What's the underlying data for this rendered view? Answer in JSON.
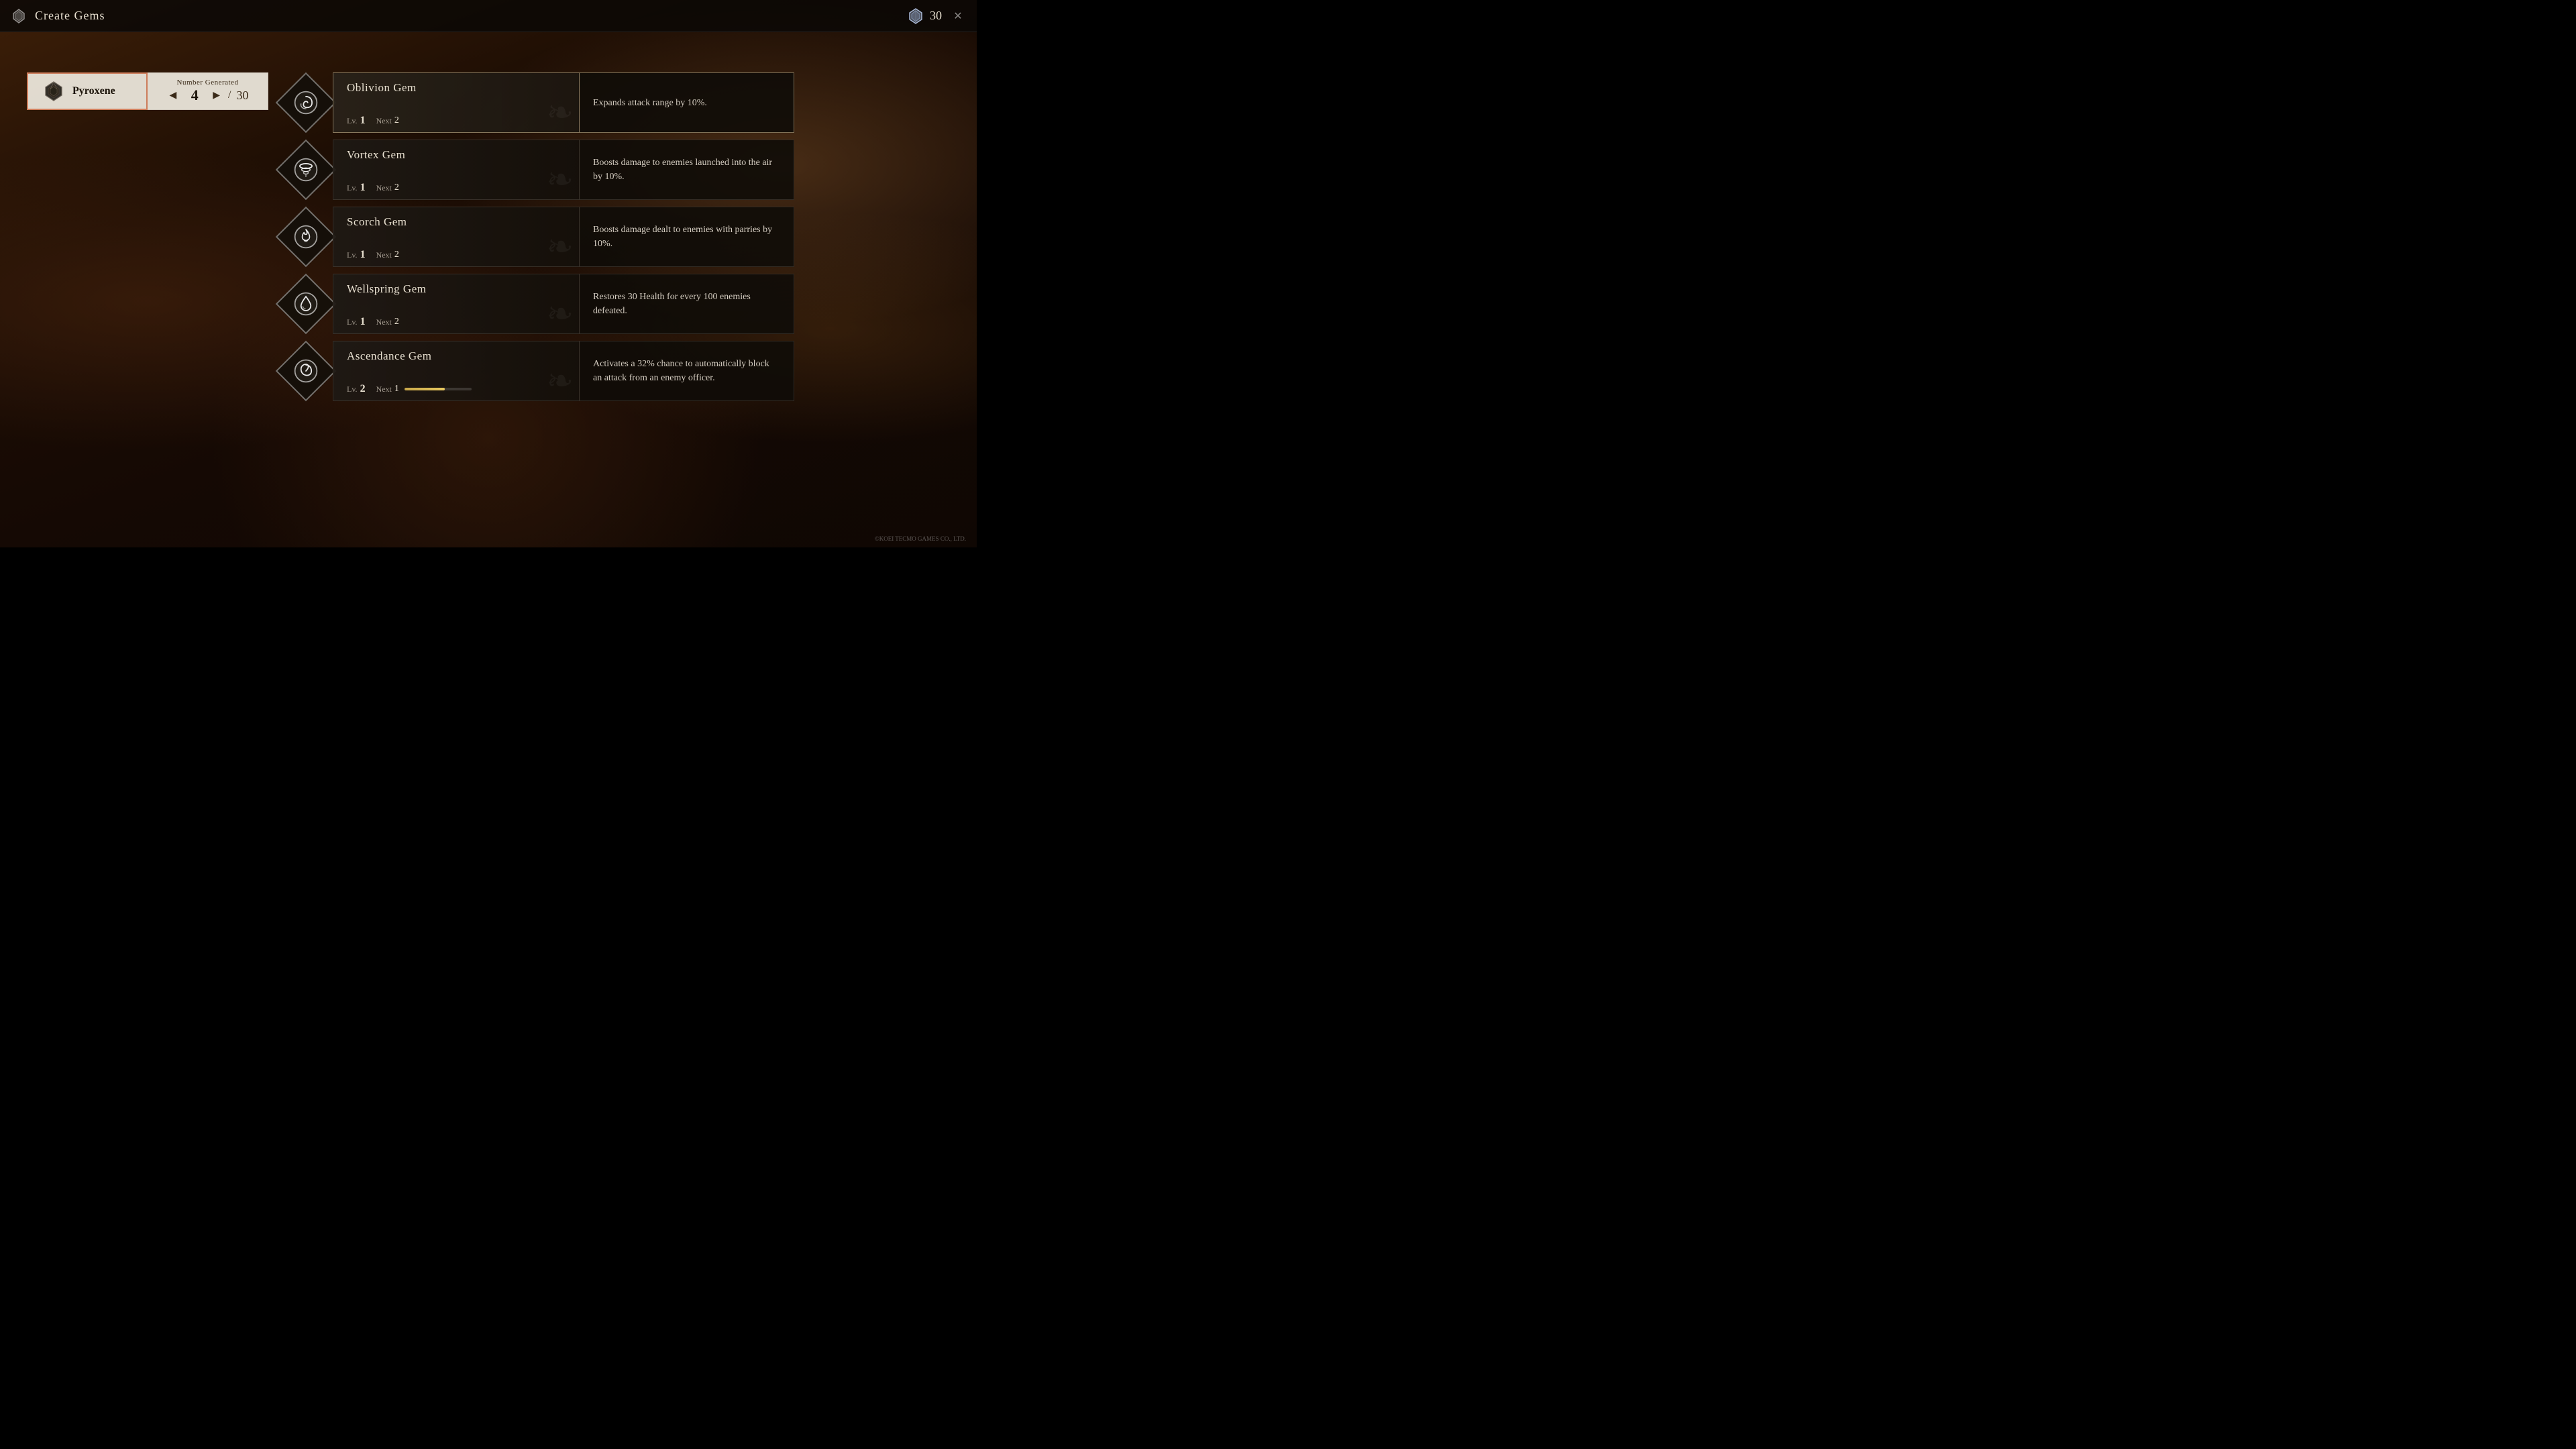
{
  "topbar": {
    "icon_label": "gem-icon",
    "title": "Create Gems",
    "currency_icon_label": "crystal-icon",
    "currency_value": "30",
    "close_label": "✕"
  },
  "gem_selector": {
    "gem_type_label": "Pyroxene",
    "number_generated_label": "Number Generated",
    "current_value": "4",
    "separator": "/",
    "max_value": "30"
  },
  "gems": [
    {
      "name": "Oblivion Gem",
      "level_label": "Lv.",
      "level": "1",
      "next_label": "Next",
      "next_value": "2",
      "progress": 0,
      "description": "Expands attack range by 10%.",
      "selected": true,
      "icon_type": "swirl"
    },
    {
      "name": "Vortex Gem",
      "level_label": "Lv.",
      "level": "1",
      "next_label": "Next",
      "next_value": "2",
      "progress": 0,
      "description": "Boosts damage to enemies launched into the air by 10%.",
      "selected": false,
      "icon_type": "tornado"
    },
    {
      "name": "Scorch Gem",
      "level_label": "Lv.",
      "level": "1",
      "next_label": "Next",
      "next_value": "2",
      "progress": 0,
      "description": "Boosts damage dealt to enemies with parries by 10%.",
      "selected": false,
      "icon_type": "flame"
    },
    {
      "name": "Wellspring Gem",
      "level_label": "Lv.",
      "level": "1",
      "next_label": "Next",
      "next_value": "2",
      "progress": 0,
      "description": "Restores 30 Health for every 100 enemies defeated.",
      "selected": false,
      "icon_type": "drop"
    },
    {
      "name": "Ascendance Gem",
      "level_label": "Lv.",
      "level": "2",
      "next_label": "Next",
      "next_value": "1",
      "progress": 60,
      "description": "Activates a 32% chance to automatically block an attack from an enemy officer.",
      "selected": false,
      "icon_type": "spiral"
    }
  ],
  "copyright": "©KOEI TECMO GAMES CO., LTD."
}
